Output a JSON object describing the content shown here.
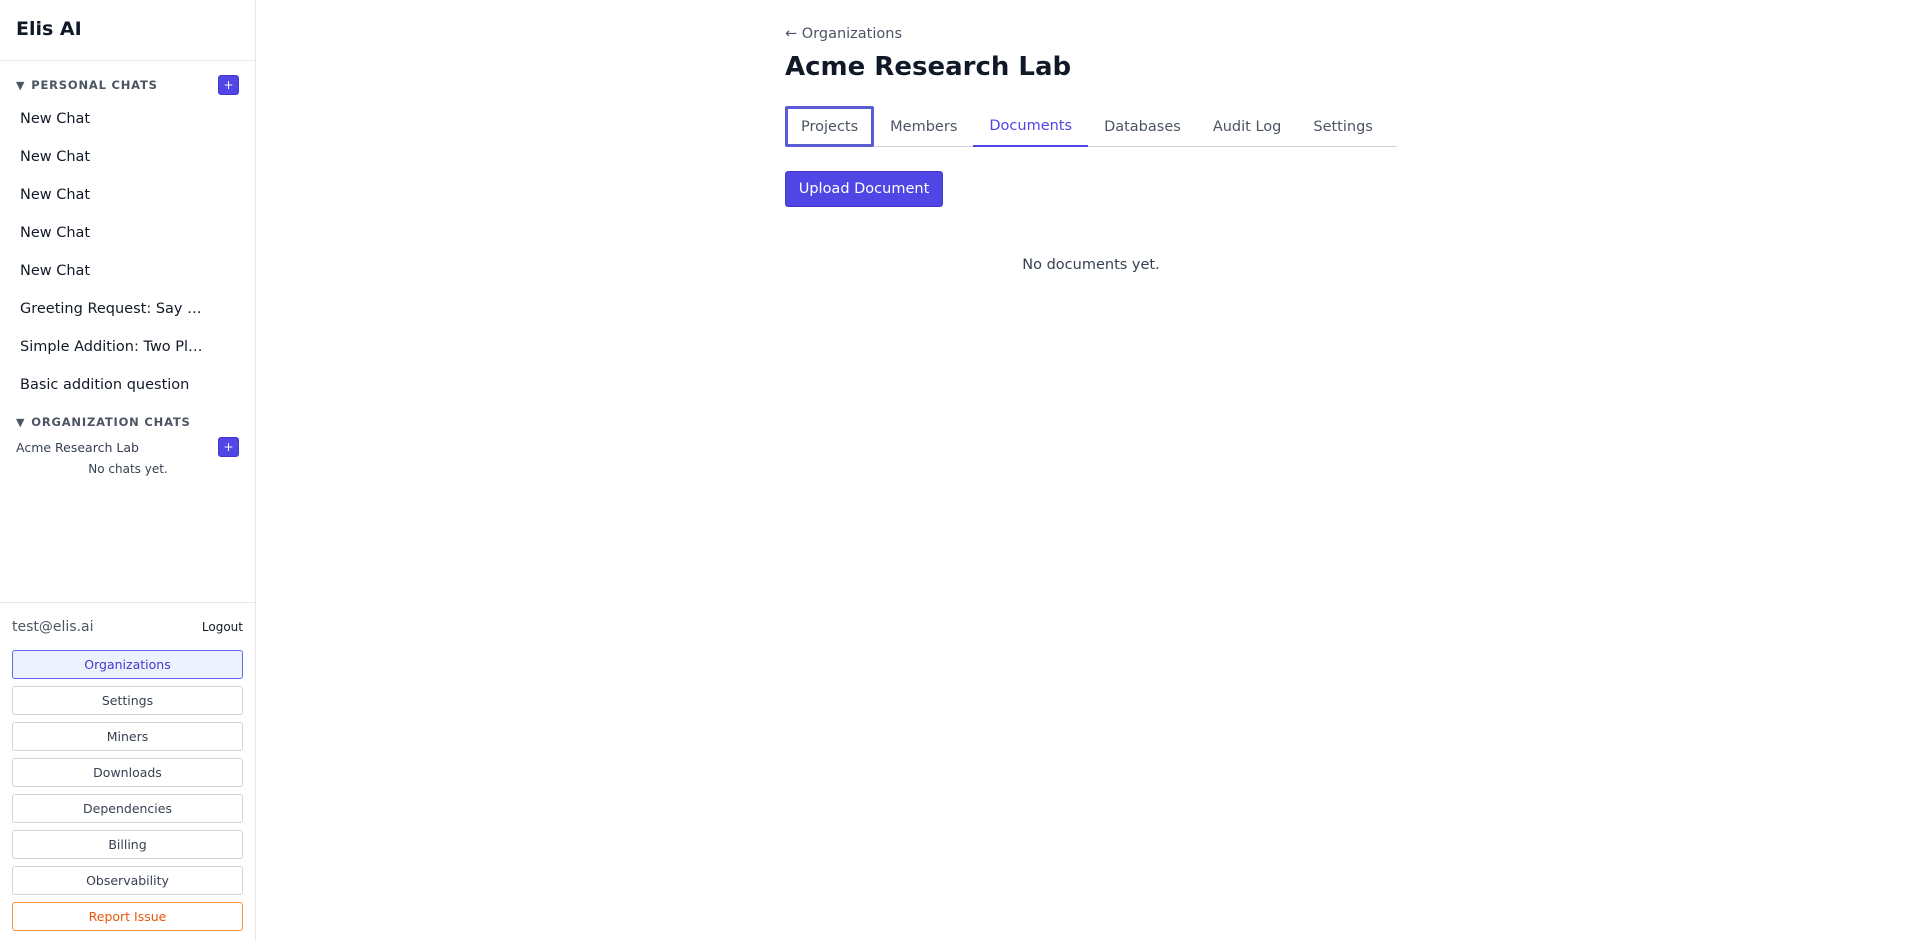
{
  "sidebar": {
    "brand": "Elis AI",
    "personal": {
      "title": "PERSONAL CHATS",
      "add_label": "+",
      "chats": [
        "New Chat",
        "New Chat",
        "New Chat",
        "New Chat",
        "New Chat",
        "Greeting Request: Say …",
        "Simple Addition: Two Pl…",
        "Basic addition question"
      ]
    },
    "organization": {
      "title": "ORGANIZATION CHATS",
      "org_name": "Acme Research Lab",
      "add_label": "+",
      "empty": "No chats yet."
    },
    "footer": {
      "email": "test@elis.ai",
      "logout": "Logout",
      "nav": [
        "Organizations",
        "Settings",
        "Miners",
        "Downloads",
        "Dependencies",
        "Billing",
        "Observability",
        "Report Issue"
      ],
      "active": "Organizations"
    }
  },
  "main": {
    "back_link": "← Organizations",
    "title": "Acme Research Lab",
    "tabs": [
      "Projects",
      "Members",
      "Documents",
      "Databases",
      "Audit Log",
      "Settings"
    ],
    "active_tab": "Documents",
    "focused_tab": "Projects",
    "upload_button": "Upload Document",
    "empty_state": "No documents yet."
  },
  "colors": {
    "accent": "#4f46e5",
    "report": "#ea580c"
  }
}
